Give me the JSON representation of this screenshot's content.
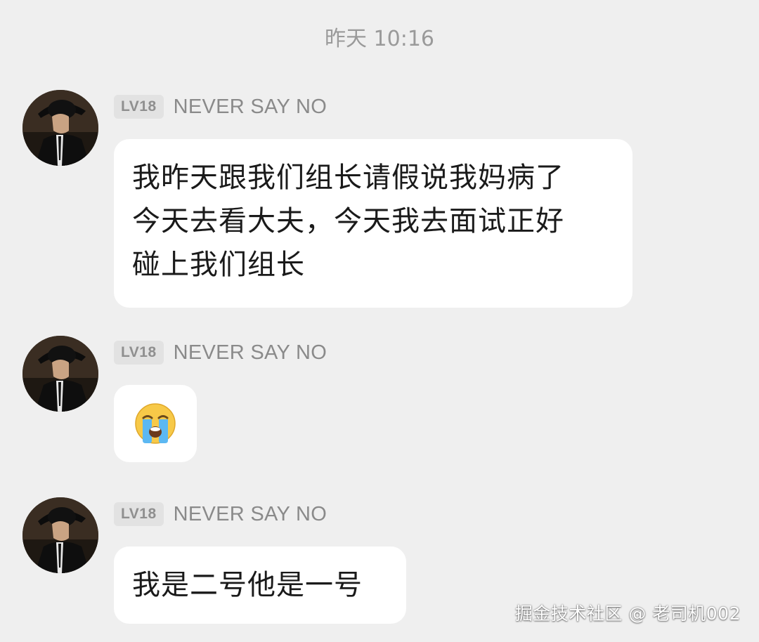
{
  "chat": {
    "timestamp": "昨天 10:16",
    "messages": [
      {
        "level_badge": "LV18",
        "sender": "NEVER SAY NO",
        "avatar": "avatar-man-in-black-hat",
        "lines": [
          "我昨天跟我们组长请假说我妈病了",
          "今天去看大夫，今天我去面试正好",
          "碰上我们组长"
        ]
      },
      {
        "level_badge": "LV18",
        "sender": "NEVER SAY NO",
        "avatar": "avatar-man-in-black-hat",
        "emoji": "loudly-crying-face"
      },
      {
        "level_badge": "LV18",
        "sender": "NEVER SAY NO",
        "avatar": "avatar-man-in-black-hat",
        "text": "我是二号他是一号"
      }
    ]
  },
  "watermark": "掘金技术社区 @ 老司机002",
  "colors": {
    "background": "#efefef",
    "bubble": "#ffffff",
    "badge_background": "#e2e2e2",
    "muted_text": "#8a8a8a",
    "message_text": "#1a1a1a"
  }
}
